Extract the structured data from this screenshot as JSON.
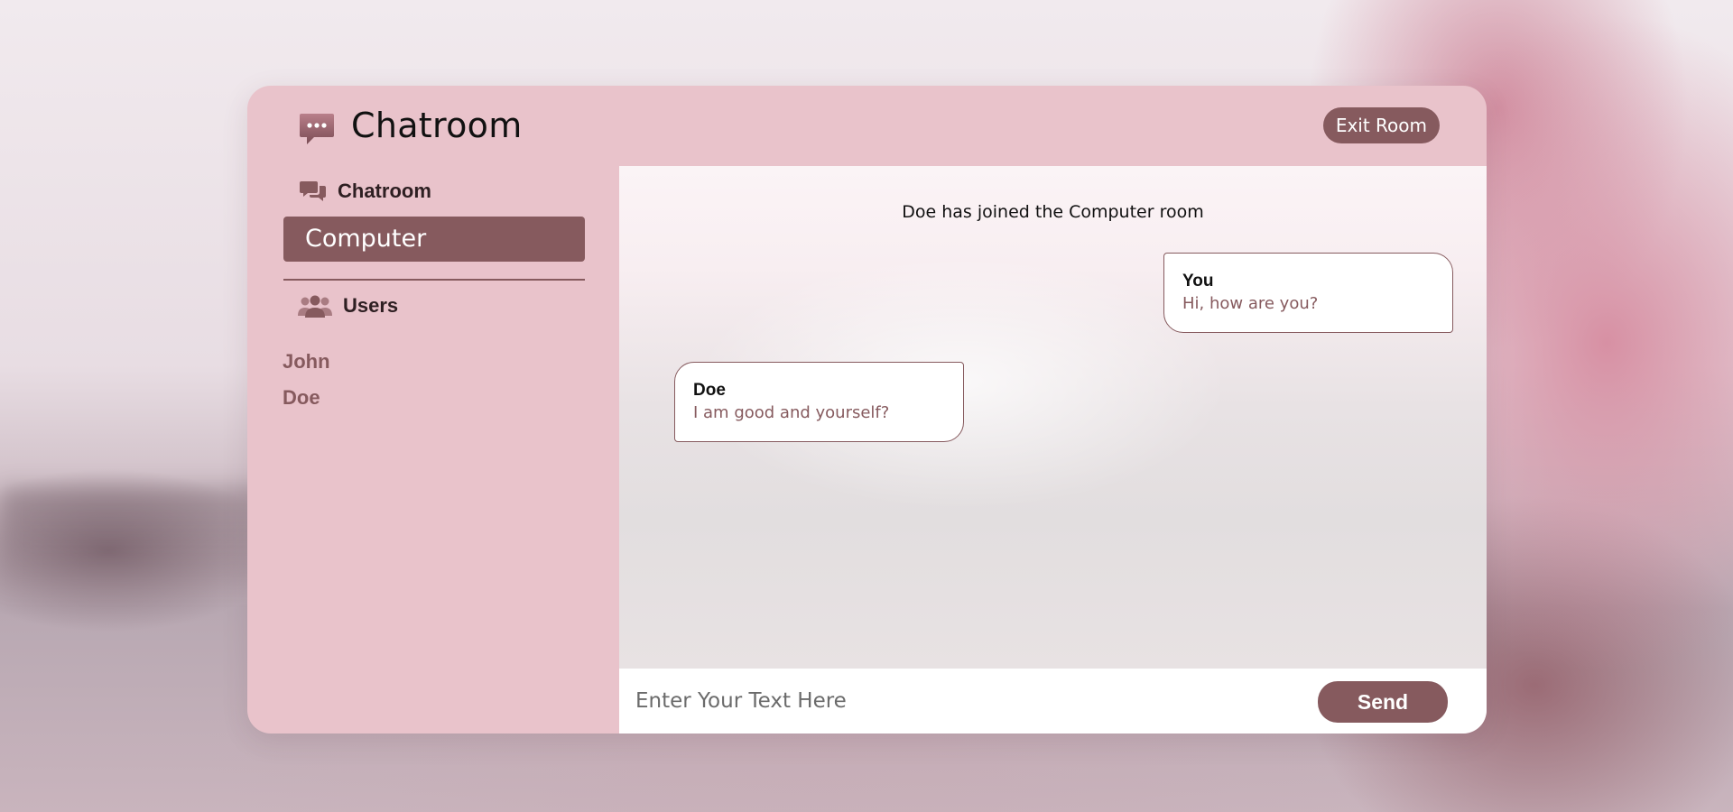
{
  "header": {
    "logo_icon": "chat-bubble-icon",
    "title": "Chatroom",
    "exit_label": "Exit Room"
  },
  "sidebar": {
    "room_heading": "Chatroom",
    "room_heading_icon": "comments-icon",
    "current_room": "Computer",
    "users_heading": "Users",
    "users_heading_icon": "users-icon",
    "users": [
      "John",
      "Doe"
    ]
  },
  "chat": {
    "system_message": "Doe has joined the Computer room",
    "messages": [
      {
        "sender": "You",
        "text": "Hi, how are you?"
      },
      {
        "sender": "Doe",
        "text": "I am good and yourself?"
      }
    ]
  },
  "composer": {
    "placeholder": "Enter Your Text Here",
    "value": "",
    "send_label": "Send"
  },
  "colors": {
    "panel": "#e9c3cb",
    "accent": "#865a5e",
    "bubble_border": "#865a5e"
  }
}
